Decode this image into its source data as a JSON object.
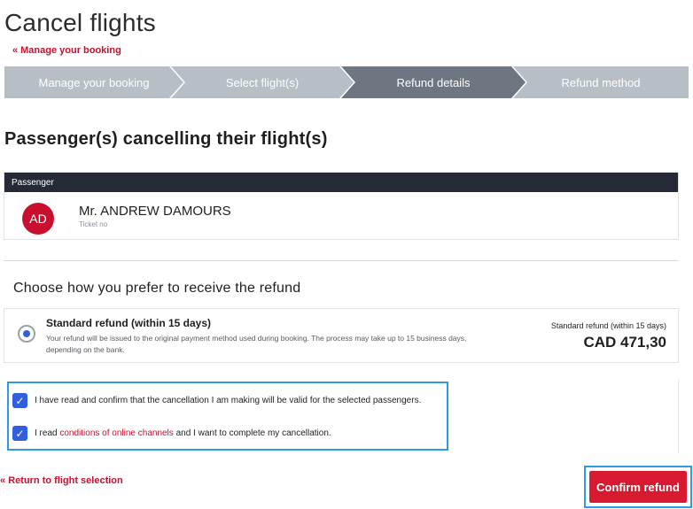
{
  "page": {
    "title": "Cancel flights",
    "back_link": "Manage your booking",
    "back_arrow": "«"
  },
  "steps": [
    {
      "label": "Manage your booking",
      "active": false
    },
    {
      "label": "Select flight(s)",
      "active": false
    },
    {
      "label": "Refund details",
      "active": true
    },
    {
      "label": "Refund method",
      "active": false
    }
  ],
  "passengers": {
    "section_title": "Passenger(s) cancelling their flight(s)",
    "header": "Passenger",
    "items": [
      {
        "initials": "AD",
        "name": "Mr. ANDREW DAMOURS",
        "ticket_label": "Ticket no"
      }
    ]
  },
  "refund": {
    "section_title": "Choose how you prefer to receive the refund",
    "option": {
      "title": "Standard refund (within 15 days)",
      "description": "Your refund will be issued to the original payment method used during booking. The process may take up to 15 business days, depending on the bank.",
      "right_label": "Standard refund (within 15 days)",
      "amount": "CAD 471,30",
      "selected": true
    }
  },
  "confirmations": {
    "check1": "I have read and confirm that the cancellation I am making will be valid for the selected passengers.",
    "check2_prefix": "I read ",
    "check2_link": "conditions of online channels",
    "check2_suffix": " and I want to complete my cancellation.",
    "checkmark": "✓"
  },
  "footer": {
    "return_link": "Return to flight selection",
    "return_arrow": "«",
    "confirm_button": "Confirm refund"
  },
  "colors": {
    "brand_red": "#c8102e",
    "step_inactive": "#b8bec6",
    "step_active": "#6e7682",
    "header_dark": "#252a36",
    "checkbox_blue": "#2f5fe0",
    "highlight_blue": "#2d9be0"
  }
}
